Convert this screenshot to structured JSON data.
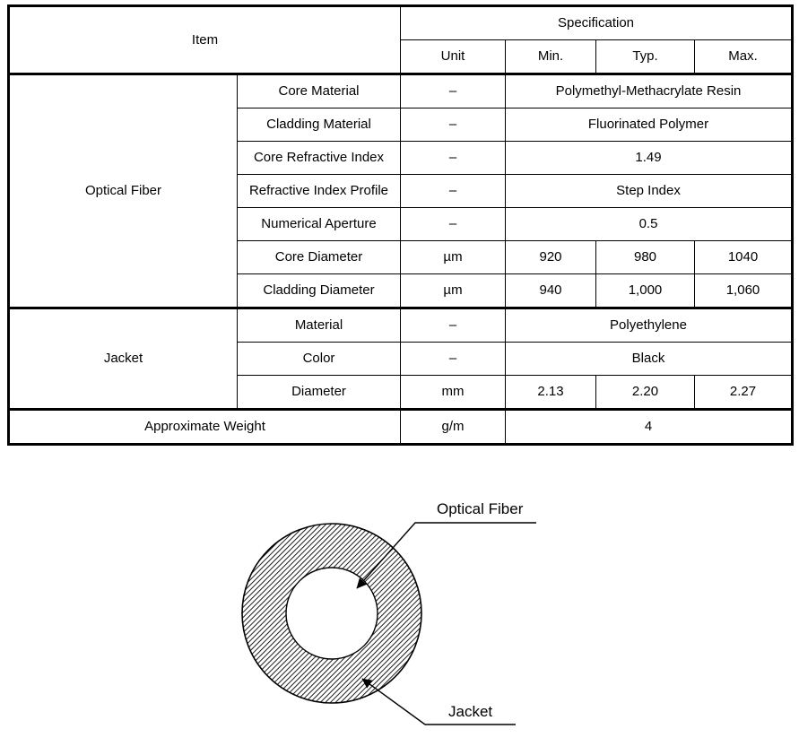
{
  "table": {
    "header": {
      "item": "Item",
      "specification": "Specification",
      "unit": "Unit",
      "min": "Min.",
      "typ": "Typ.",
      "max": "Max."
    },
    "groups": [
      {
        "name": "Optical Fiber",
        "rows": [
          {
            "item": "Core Material",
            "unit": "–",
            "span": "Polymethyl-Methacrylate Resin"
          },
          {
            "item": "Cladding Material",
            "unit": "–",
            "span": "Fluorinated Polymer"
          },
          {
            "item": "Core Refractive Index",
            "unit": "–",
            "span": "1.49"
          },
          {
            "item": "Refractive Index Profile",
            "unit": "–",
            "span": "Step Index"
          },
          {
            "item": "Numerical Aperture",
            "unit": "–",
            "span": "0.5"
          },
          {
            "item": "Core Diameter",
            "unit": "µm",
            "min": "920",
            "typ": "980",
            "max": "1040"
          },
          {
            "item": "Cladding Diameter",
            "unit": "µm",
            "min": "940",
            "typ": "1,000",
            "max": "1,060"
          }
        ]
      },
      {
        "name": "Jacket",
        "rows": [
          {
            "item": "Material",
            "unit": "–",
            "span": "Polyethylene"
          },
          {
            "item": "Color",
            "unit": "–",
            "span": "Black"
          },
          {
            "item": "Diameter",
            "unit": "mm",
            "min": "2.13",
            "typ": "2.20",
            "max": "2.27"
          }
        ]
      }
    ],
    "footer_row": {
      "item": "Approximate Weight",
      "unit": "g/m",
      "span": "4"
    }
  },
  "diagram": {
    "labels": {
      "optical_fiber": "Optical Fiber",
      "jacket": "Jacket"
    },
    "colors": {
      "stroke": "#000000",
      "fill": "#ffffff",
      "hatch": "#1a1a1a"
    }
  }
}
